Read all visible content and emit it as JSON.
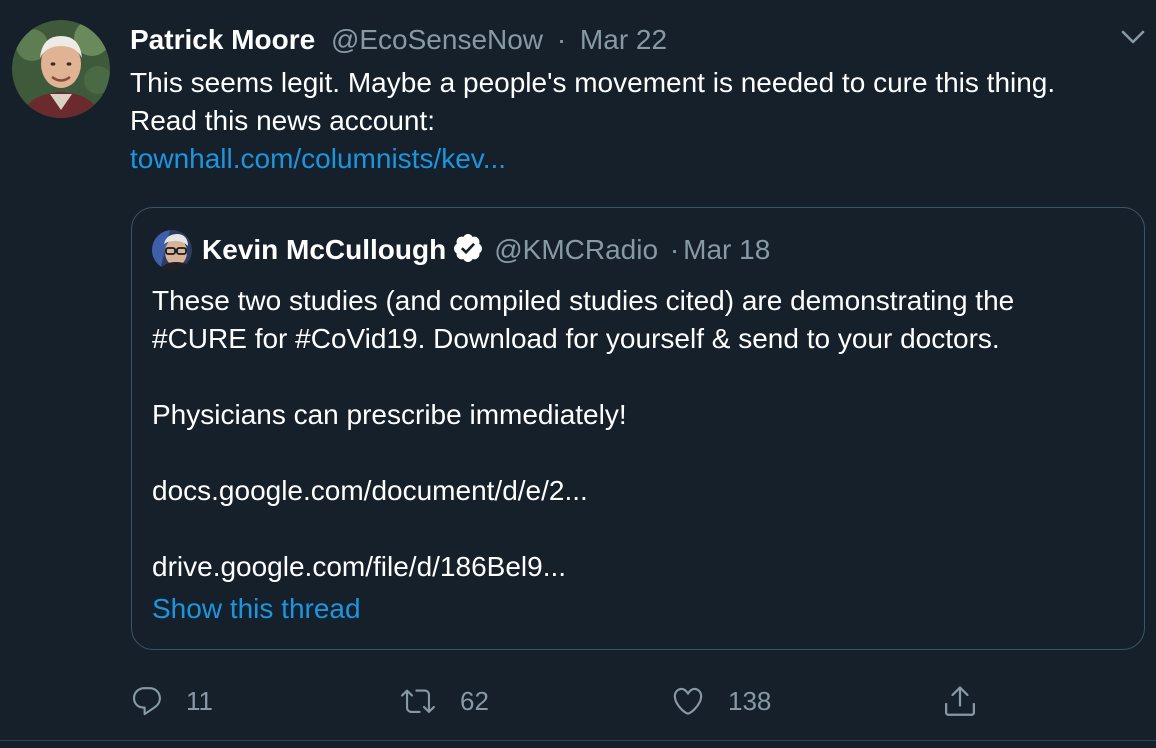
{
  "tweet": {
    "author_name": "Patrick Moore",
    "author_handle": "@EcoSenseNow",
    "separator": "·",
    "date": "Mar 22",
    "text_line1": "This seems legit. Maybe a people's movement is needed to cure this thing.",
    "text_line2": "Read this news account:",
    "link_text": "townhall.com/columnists/kev..."
  },
  "quoted_tweet": {
    "author_name": "Kevin McCullough",
    "verified": true,
    "author_handle": "@KMCRadio",
    "separator": "·",
    "date": "Mar 18",
    "lines": [
      "These two studies (and compiled studies cited) are demonstrating the",
      "#CURE for #CoVid19. Download for yourself & send to your doctors.",
      "",
      "Physicians can prescribe immediately!",
      "",
      "docs.google.com/document/d/e/2...",
      "",
      "drive.google.com/file/d/186Bel9..."
    ],
    "show_thread": "Show this thread"
  },
  "actions": {
    "reply_count": "11",
    "retweet_count": "62",
    "like_count": "138"
  },
  "icons": {
    "reply": "reply-icon",
    "retweet": "retweet-icon",
    "like": "heart-icon",
    "share": "share-icon",
    "menu": "chevron-down-icon",
    "verified": "verified-badge-icon"
  },
  "colors": {
    "background": "#15202b",
    "link": "#1b95e0",
    "secondary_text": "#8899a6",
    "border": "#3d5466"
  }
}
